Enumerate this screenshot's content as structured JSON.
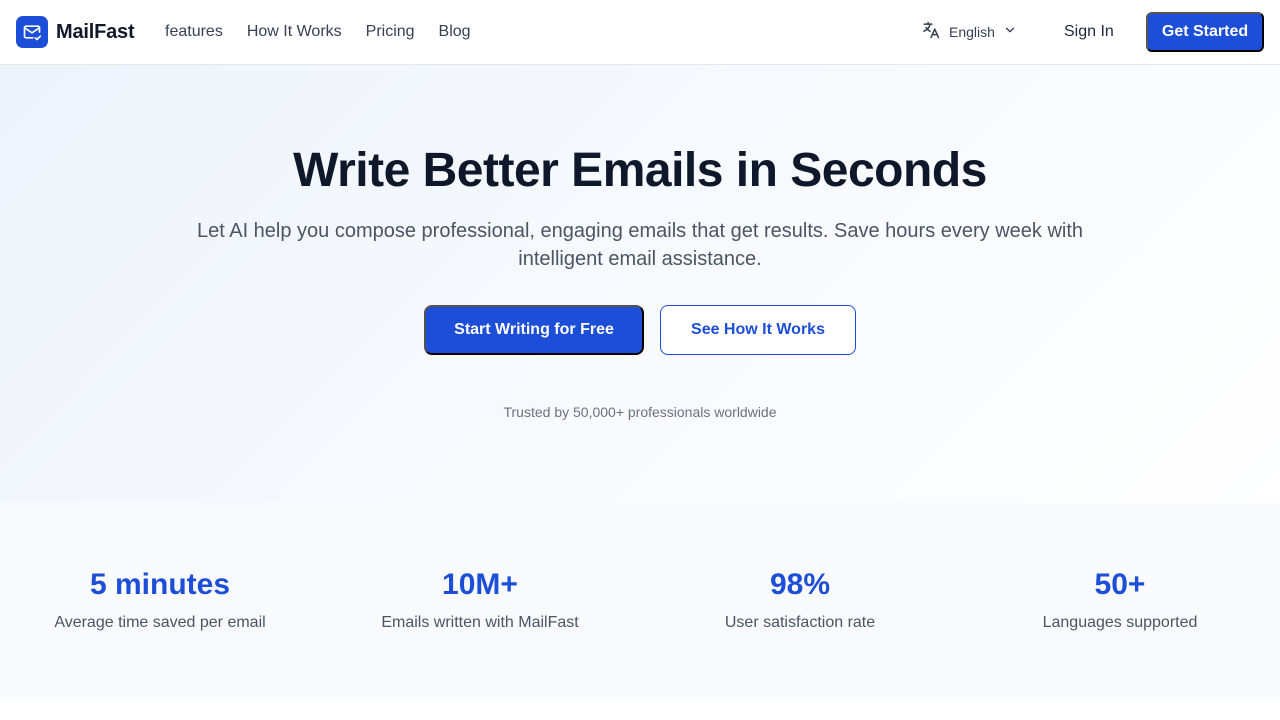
{
  "nav": {
    "brand": "MailFast",
    "links": [
      "features",
      "How It Works",
      "Pricing",
      "Blog"
    ],
    "language": "English",
    "sign_in": "Sign In",
    "get_started": "Get Started"
  },
  "hero": {
    "title": "Write Better Emails in Seconds",
    "subtitle": "Let AI help you compose professional, engaging emails that get results. Save hours every week with intelligent email assistance.",
    "primary_cta": "Start Writing for Free",
    "secondary_cta": "See How It Works",
    "trusted": "Trusted by 50,000+ professionals worldwide"
  },
  "stats": [
    {
      "value": "5 minutes",
      "label": "Average time saved per email"
    },
    {
      "value": "10M+",
      "label": "Emails written with MailFast"
    },
    {
      "value": "98%",
      "label": "User satisfaction rate"
    },
    {
      "value": "50+",
      "label": "Languages supported"
    }
  ],
  "colors": {
    "accent": "#1d4ed8",
    "heading": "#0f172a",
    "body_text": "#4b5563",
    "hero_background": "#eef4fc",
    "stats_background": "#f8fafc"
  },
  "icons": {
    "logo": "mail-check-icon",
    "language": "translate-icon",
    "language_chevron": "chevron-down-icon"
  }
}
